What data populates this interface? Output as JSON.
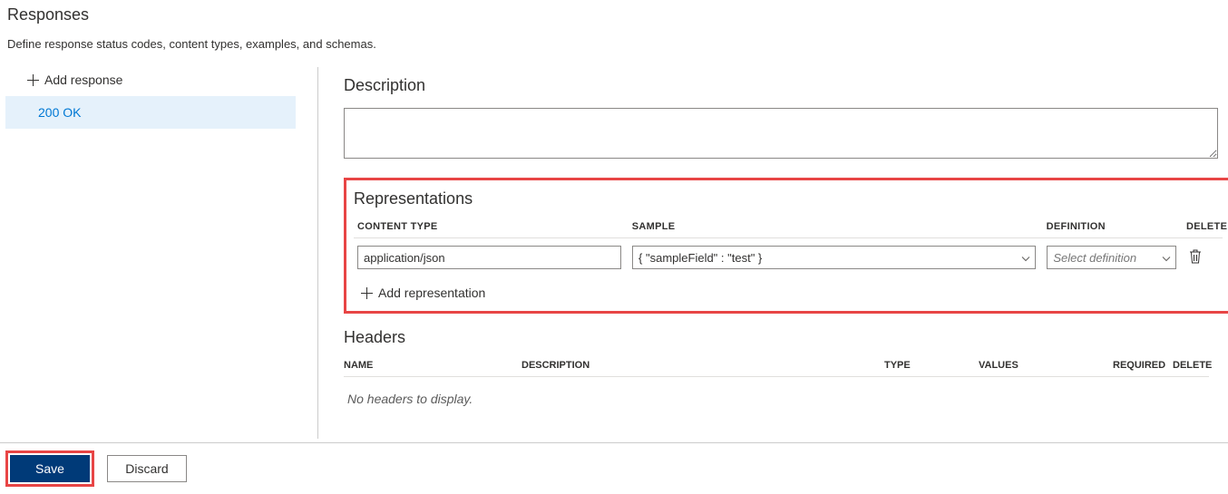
{
  "title": "Responses",
  "subtitle": "Define response status codes, content types, examples, and schemas.",
  "sidebar": {
    "add_response_label": "Add response",
    "items": [
      {
        "label": "200 OK"
      }
    ]
  },
  "description": {
    "heading": "Description",
    "value": ""
  },
  "representations": {
    "heading": "Representations",
    "columns": {
      "content_type": "CONTENT TYPE",
      "sample": "SAMPLE",
      "definition": "DEFINITION",
      "delete": "DELETE"
    },
    "rows": [
      {
        "content_type": "application/json",
        "sample": "{ \"sampleField\" : \"test\" }",
        "definition_placeholder": "Select definition"
      }
    ],
    "add_label": "Add representation"
  },
  "headers": {
    "heading": "Headers",
    "columns": {
      "name": "NAME",
      "description": "DESCRIPTION",
      "type": "TYPE",
      "values": "VALUES",
      "required": "REQUIRED",
      "delete": "DELETE"
    },
    "empty_message": "No headers to display."
  },
  "footer": {
    "save": "Save",
    "discard": "Discard"
  }
}
